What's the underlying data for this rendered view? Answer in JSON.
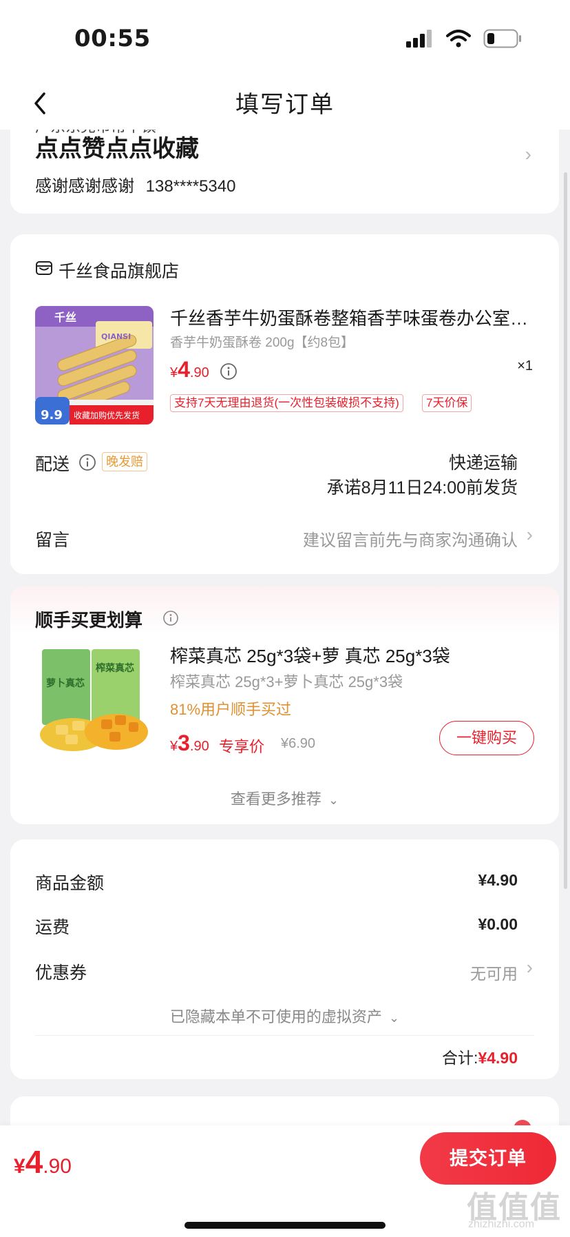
{
  "status_bar": {
    "time": "00:55",
    "icons": [
      "signal-icon",
      "wifi-icon",
      "battery-icon"
    ]
  },
  "nav": {
    "title": "填写订单"
  },
  "address": {
    "region_partial": "广东东莞市常平镇",
    "detail": "点点赞点点收藏",
    "name": "感谢感谢感谢",
    "phone": "138****5340"
  },
  "store": {
    "name": "千丝食品旗舰店",
    "product": {
      "title": "千丝香芋牛奶蛋酥卷整箱香芋味蛋卷办公室…",
      "spec": "香芋牛奶蛋酥卷 200g【约8包】",
      "price_symbol": "¥",
      "price_int": "4",
      "price_dec": ".90",
      "quantity": "×1",
      "image_brand": "千丝",
      "image_brand_en": "QIANSI",
      "image_price": "9.9",
      "image_banner": "收藏加购优先发货"
    },
    "tags": [
      "支持7天无理由退货(一次性包装破损不支持)",
      "7天价保"
    ],
    "delivery_label": "配送",
    "late_badge": "晚发赔",
    "delivery_method": "快递运输",
    "delivery_promise": "承诺8月11日24:00前发货",
    "message_label": "留言",
    "message_placeholder": "建议留言前先与商家沟通确认"
  },
  "recommend": {
    "title": "顺手买更划算",
    "item": {
      "name": "榨菜真芯 25g*3袋+萝 真芯 25g*3袋",
      "spec": "榨菜真芯 25g*3+萝卜真芯 25g*3袋",
      "social": "81%用户顺手买过",
      "price_symbol": "¥",
      "price_int": "3",
      "price_dec": ".90",
      "exclusive": "专享价",
      "original": "¥6.90",
      "image_left": "萝卜真芯",
      "image_right": "榨菜真芯"
    },
    "buy_label": "一键购买",
    "more_label": "查看更多推荐"
  },
  "summary": {
    "goods_label": "商品金额",
    "goods_value": "¥4.90",
    "shipping_label": "运费",
    "shipping_value": "¥0.00",
    "coupon_label": "优惠券",
    "coupon_value": "无可用",
    "hidden_assets": "已隐藏本单不可使用的虚拟资产",
    "total_label": "合计:",
    "total_value": "¥4.90"
  },
  "bottom": {
    "price_symbol": "¥",
    "price_int": "4",
    "price_dec": ".90",
    "submit_label": "提交订单"
  },
  "watermark": {
    "text": "值值值",
    "sub": "zhizhizhi.com"
  },
  "colors": {
    "accent": "#e8202c",
    "orange": "#e09030",
    "bg": "#f2f2f4"
  }
}
